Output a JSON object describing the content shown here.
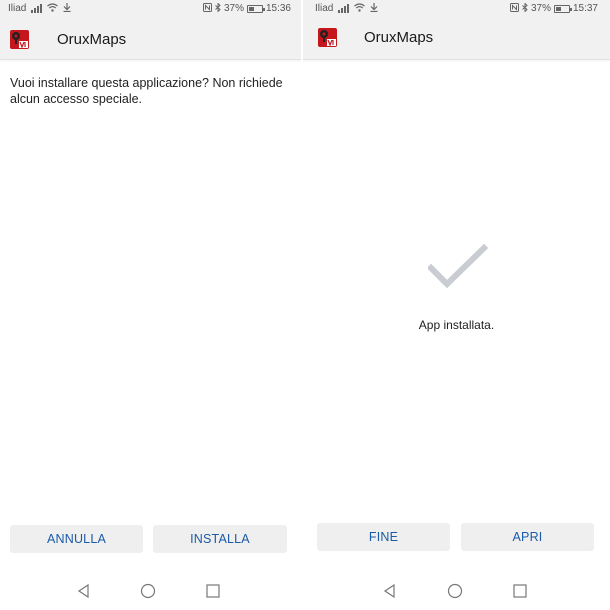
{
  "left": {
    "status": {
      "carrier": "Iliad",
      "battery": "37%",
      "battery_fraction": 0.37,
      "time": "15:36"
    },
    "appbar": {
      "title": "OruxMaps",
      "icon": "oruxmaps-app-icon"
    },
    "prompt": "Vuoi installare questa applicazione? Non richiede alcun accesso speciale.",
    "buttons": {
      "cancel": "ANNULLA",
      "install": "INSTALLA"
    }
  },
  "right": {
    "status": {
      "carrier": "Iliad",
      "battery": "37%",
      "battery_fraction": 0.37,
      "time": "15:37"
    },
    "appbar": {
      "title": "OruxMaps",
      "icon": "oruxmaps-app-icon"
    },
    "installed_message": "App installata.",
    "buttons": {
      "done": "FINE",
      "open": "APRI"
    }
  },
  "navbar": {
    "back": "back-icon",
    "home": "home-icon",
    "recents": "recents-icon"
  },
  "colors": {
    "accent": "#1a5aa8",
    "appbar_bg": "#f1f1f1",
    "button_bg": "#efefef",
    "check": "#c9ccd3",
    "app_icon_red": "#c4161c"
  }
}
